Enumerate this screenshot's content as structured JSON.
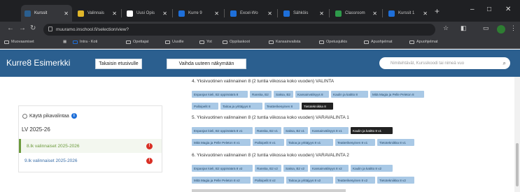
{
  "browser": {
    "tabs": [
      {
        "label": "Kurssit",
        "fav": "#2b5f8f",
        "active": true
      },
      {
        "label": "Valinnais",
        "fav": "#e0b62a"
      },
      {
        "label": "Uusi Opis",
        "fav": "#ffffff"
      },
      {
        "label": "Kurre 9",
        "fav": "#1e6fd9"
      },
      {
        "label": "Excel-Wo",
        "fav": "#1e6fd9"
      },
      {
        "label": "Sähköis",
        "fav": "#1e6fd9"
      },
      {
        "label": "Classroom",
        "fav": "#2e9b4b"
      },
      {
        "label": "Kurssit 1",
        "fav": "#1e6fd9"
      }
    ],
    "new_tab": "+",
    "window_controls": {
      "min": "–",
      "max": "□",
      "close": "✕"
    },
    "url": "muuramo.inschool.fi/selection/view?",
    "bookmarks": [
      "Muovaamiset",
      "Intra - Koti",
      "Opettajat",
      "Uusille",
      "Yot",
      "Oppilaskoot",
      "Kansainvalista",
      "Opetusjulkis",
      "Apuohjelmat",
      "Apuohjelmat"
    ]
  },
  "app": {
    "title": "Kurre8 Esimerkki",
    "buttons": {
      "front": "Takaisin etusivulle",
      "switch_view": "Vaihda uuteen näkymään"
    },
    "search_placeholder": "Nimitehtävät, Kurssikoodi tai nimeä vuo"
  },
  "left": {
    "checkbox_label": "Käytä pikavalintaa",
    "year_label": "LV 2025-26",
    "rows": [
      {
        "label": "8.lk valinnaiset 2025-2026",
        "alert": "!"
      },
      {
        "label": "9.lk valinnaiset 2025-2026",
        "alert": "!"
      }
    ]
  },
  "sections": [
    {
      "title": "4. Yksivuotinen valinnainen 8 (2 tuntia viikossa koko vuoden) VALINTA",
      "rows": [
        [
          {
            "label": "Espanjan kieli, B2 oppimäärä 8",
            "dark": false
          },
          {
            "label": "Ranska, B2",
            "dark": false
          },
          {
            "label": "Saksa, B2",
            "dark": false
          },
          {
            "label": "Kansainvälisyys 8",
            "dark": false
          },
          {
            "label": "Kaulin ja katitto 8",
            "dark": false
          },
          {
            "label": "Mitä Magia ja Pelle Peleton 8",
            "dark": false
          }
        ],
        [
          {
            "label": "Palloipelit 8",
            "dark": false
          },
          {
            "label": "Taitoa ja yrittäjyys 8",
            "dark": false
          },
          {
            "label": "Teatterikesyinen 8",
            "dark": false
          },
          {
            "label": "Tietotekniikka 8",
            "dark": true
          }
        ]
      ]
    },
    {
      "title": "5. Yksivuotinen valinnainen 8 (2 tuntia viikossa koko vuoden) VARAVALINTA 1",
      "rows": [
        [
          {
            "label": "Espanjan kieli, B2 oppimäärä 8 v1",
            "dark": false
          },
          {
            "label": "Ranska, B2 v1",
            "dark": false
          },
          {
            "label": "Saksa, B2 v1",
            "dark": false
          },
          {
            "label": "Kansainvälisyys 8 v1",
            "dark": false
          },
          {
            "label": "Kaulin ja katitto 8 v1",
            "dark": true
          }
        ],
        [
          {
            "label": "Mitä Magia ja Pelle Peleton 8 v1",
            "dark": false
          },
          {
            "label": "Palloipelit 8 v1",
            "dark": false
          },
          {
            "label": "Taitoa ja yrittäjyys 8 v1",
            "dark": false
          },
          {
            "label": "Teatterikesyinen 8 v1",
            "dark": false
          },
          {
            "label": "Tietotekniikka 8 v1",
            "dark": false
          }
        ]
      ]
    },
    {
      "title": "6. Yksivuotinen valinnainen 8 (2 tuntia viikossa koko vuoden) VARAVALINTA 2",
      "rows": [
        [
          {
            "label": "Espanjan kieli, B2 oppimäärä 8 v2",
            "dark": false
          },
          {
            "label": "Ranska, B2 v2",
            "dark": false
          },
          {
            "label": "Saksa, B2 v2",
            "dark": false
          },
          {
            "label": "Kansainvälisyys 8 v2",
            "dark": false
          },
          {
            "label": "Kaulin ja katitto 8 v2",
            "dark": false
          }
        ],
        [
          {
            "label": "Mitä Magia ja Pelle Peleton 8 v2",
            "dark": false
          },
          {
            "label": "Palloipelit 8 v2",
            "dark": false
          },
          {
            "label": "Taitoa ja yrittäjyys 8 v2",
            "dark": false
          },
          {
            "label": "Teatterikesyinen 8 v2",
            "dark": false
          },
          {
            "label": "Tietotekniikka 8 v2",
            "dark": false
          }
        ]
      ]
    }
  ]
}
